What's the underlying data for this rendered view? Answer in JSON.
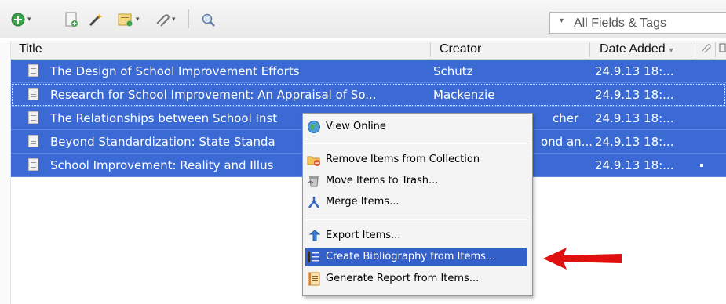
{
  "toolbar": {
    "new_item_icon": "new-item-icon",
    "new_note_icon": "new-note-icon",
    "tag_icon": "wand-icon",
    "note_icon": "new-note-dropdown-icon",
    "attach_icon": "paperclip-icon",
    "search_icon": "magnifier-icon"
  },
  "search": {
    "mode_icon": "dropdown-caret",
    "placeholder": "All Fields & Tags"
  },
  "columns": {
    "title": "Title",
    "creator": "Creator",
    "date_added": "Date Added"
  },
  "rows": [
    {
      "title": "The Design of School Improvement Efforts",
      "creator": "Schutz",
      "date": "24.9.13 18:..."
    },
    {
      "title": "Research for School Improvement: An Appraisal of So...",
      "creator": "Mackenzie",
      "date": "24.9.13 18:..."
    },
    {
      "title": "The Relationships between School Inst",
      "creator": "cher",
      "date": "24.9.13 18:..."
    },
    {
      "title": "Beyond Standardization: State Standa",
      "creator": "ond an...",
      "date": "24.9.13 18:..."
    },
    {
      "title": "School Improvement: Reality and Illus",
      "creator": "",
      "date": "24.9.13 18:..."
    }
  ],
  "context_menu": {
    "view_online": "View Online",
    "remove_from_collection": "Remove Items from Collection",
    "move_to_trash": "Move Items to Trash...",
    "merge_items": "Merge Items...",
    "export_items": "Export Items...",
    "create_bibliography": "Create Bibliography from Items...",
    "generate_report": "Generate Report from Items..."
  },
  "colors": {
    "selection": "#3c6ad4",
    "menu_highlight": "#3460c9",
    "annotation_arrow": "#e01010"
  }
}
